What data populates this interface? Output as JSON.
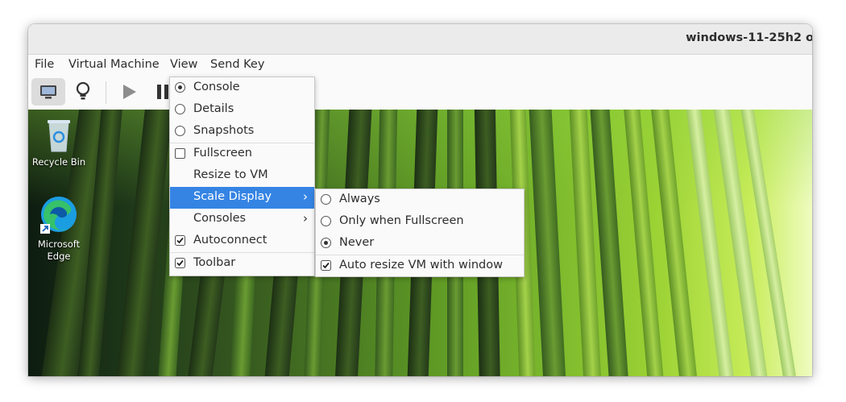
{
  "window": {
    "title": "windows-11-25h2 o"
  },
  "menubar": {
    "items": [
      "File",
      "Virtual Machine",
      "View",
      "Send Key"
    ]
  },
  "toolbar": {
    "icons": [
      "display-console-icon",
      "lightbulb-details-icon",
      "play-icon",
      "pause-icon"
    ]
  },
  "desktop": {
    "icons": [
      {
        "label": "Recycle Bin",
        "icon": "recycle-bin-icon"
      },
      {
        "label_line1": "Microsoft",
        "label_line2": "Edge",
        "icon": "edge-icon"
      }
    ]
  },
  "view_menu": {
    "items": [
      {
        "label": "Console",
        "type": "radio",
        "checked": true
      },
      {
        "label": "Details",
        "type": "radio",
        "checked": false
      },
      {
        "label": "Snapshots",
        "type": "radio",
        "checked": false
      },
      {
        "label": "Fullscreen",
        "type": "check",
        "checked": false
      },
      {
        "label": "Resize to VM",
        "type": "plain"
      },
      {
        "label": "Scale Display",
        "type": "submenu",
        "highlighted": true
      },
      {
        "label": "Consoles",
        "type": "submenu"
      },
      {
        "label": "Autoconnect",
        "type": "check",
        "checked": true
      },
      {
        "label": "Toolbar",
        "type": "check",
        "checked": true
      }
    ]
  },
  "scale_submenu": {
    "items": [
      {
        "label": "Always",
        "type": "radio",
        "checked": false
      },
      {
        "label": "Only when Fullscreen",
        "type": "radio",
        "checked": false
      },
      {
        "label": "Never",
        "type": "radio",
        "checked": true
      },
      {
        "label": "Auto resize VM with window",
        "type": "check",
        "checked": true
      }
    ]
  },
  "colors": {
    "highlight": "#3584e4",
    "menu_bg": "#fafafa",
    "text": "#2e2e2e"
  }
}
